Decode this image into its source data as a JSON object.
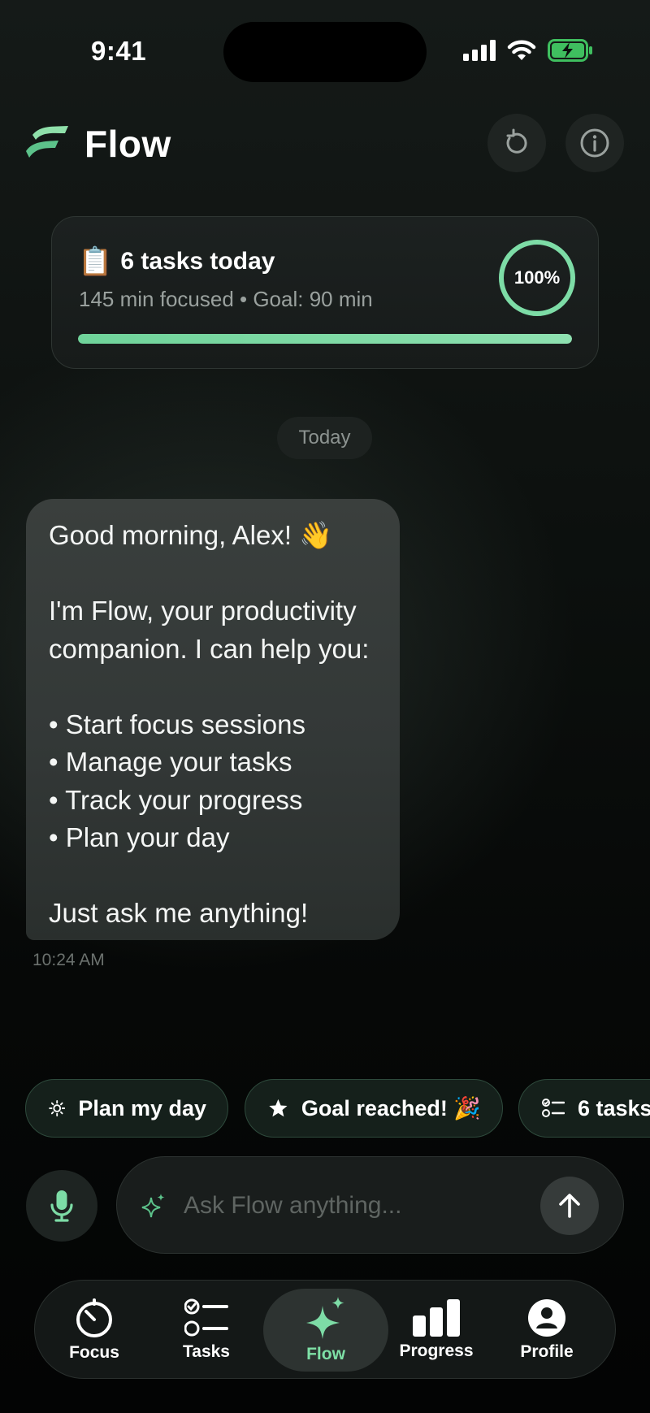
{
  "status_bar": {
    "time": "9:41"
  },
  "header": {
    "title": "Flow",
    "icons": [
      "refresh-icon",
      "info-icon"
    ]
  },
  "summary": {
    "emoji": "📋",
    "title": "6 tasks today",
    "subtitle": "145 min focused • Goal: 90 min",
    "percent_label": "100%",
    "progress": 1.0,
    "accent_color": "#7ddca6"
  },
  "date_chip": "Today",
  "message": {
    "lines": [
      "Good morning, Alex! 👋",
      "",
      "I'm Flow, your productivity",
      "companion. I can help you:",
      "",
      "• Start focus sessions",
      "• Manage your tasks",
      "• Track your progress",
      "• Plan your day",
      "",
      "Just ask me anything!"
    ],
    "time": "10:24 AM"
  },
  "quick_actions": [
    {
      "label": "Plan my day",
      "icon": "sun-icon"
    },
    {
      "label": "Goal reached! 🎉",
      "icon": "star-icon"
    },
    {
      "label": "6 tasks",
      "icon": "checklist-icon"
    }
  ],
  "composer": {
    "placeholder": "Ask Flow anything...",
    "mic_icon": "mic-icon",
    "send_icon": "arrow-up-icon"
  },
  "tabs": [
    {
      "label": "Focus",
      "icon": "timer-icon"
    },
    {
      "label": "Tasks",
      "icon": "checklist-icon"
    },
    {
      "label": "Flow",
      "icon": "sparkles-icon",
      "active": true
    },
    {
      "label": "Progress",
      "icon": "bar-chart-icon"
    },
    {
      "label": "Profile",
      "icon": "person-icon"
    }
  ]
}
